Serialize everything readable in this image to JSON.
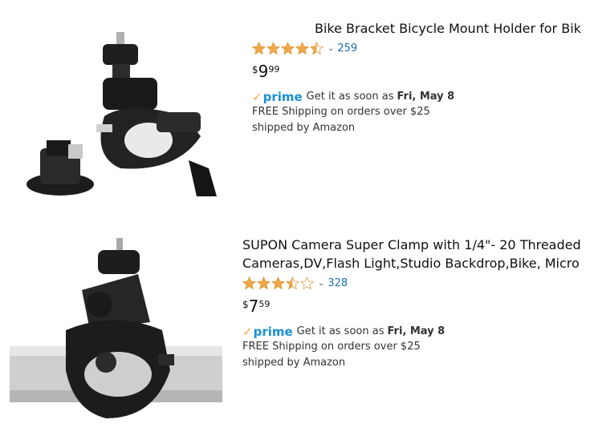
{
  "products": [
    {
      "title": "Bike Bracket Bicycle Mount Holder for Bike",
      "rating": 4.5,
      "review_count": "259",
      "price": {
        "symbol": "$",
        "whole": "9",
        "fraction": "99"
      },
      "prime_label": "prime",
      "delivery_text": "Get it as soon as",
      "delivery_date": "Fri, May 8",
      "shipping": "FREE Shipping on orders over $25",
      "shipped_by": "shipped by Amazon"
    },
    {
      "title_lines": [
        "SUPON Camera Super Clamp with 1/4\"- 20 Threaded",
        "Cameras,DV,Flash Light,Studio Backdrop,Bike, Micro"
      ],
      "rating": 3.5,
      "review_count": "328",
      "price": {
        "symbol": "$",
        "whole": "7",
        "fraction": "59"
      },
      "prime_label": "prime",
      "delivery_text": "Get it as soon as",
      "delivery_date": "Fri, May 8",
      "shipping": "FREE Shipping on orders over $25",
      "shipped_by": "shipped by Amazon"
    }
  ],
  "colors": {
    "star": "#f3a847",
    "link": "#1a6fa8",
    "prime_blue": "#1a8fd8",
    "prime_check": "#f3a847"
  },
  "icons": {
    "star": "star-icon",
    "chevron": "chevron-down-icon",
    "prime_check": "prime-check-icon"
  }
}
